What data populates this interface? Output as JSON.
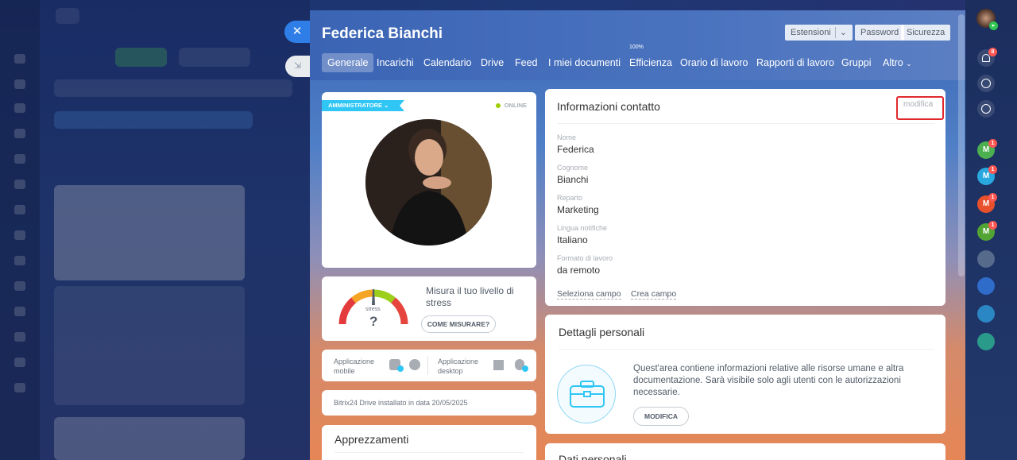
{
  "header": {
    "title": "Federica Bianchi",
    "btn_extensions": "Estensioni",
    "btn_password": "Password",
    "btn_security": "Sicurezza"
  },
  "tabs": [
    {
      "label": "Generale",
      "active": true
    },
    {
      "label": "Incarichi"
    },
    {
      "label": "Calendario"
    },
    {
      "label": "Drive"
    },
    {
      "label": "Feed"
    },
    {
      "label": "I miei documenti"
    },
    {
      "label": "Efficienza",
      "sup": "100%"
    },
    {
      "label": "Orario di lavoro"
    },
    {
      "label": "Rapporti di lavoro"
    },
    {
      "label": "Gruppi"
    },
    {
      "label": "Altro"
    }
  ],
  "profile": {
    "role_badge": "AMMINISTRATORE",
    "status": "ONLINE"
  },
  "stress": {
    "gauge_label": "stress",
    "gauge_value": "?",
    "text": "Misura il tuo livello di stress",
    "button": "COME MISURARE?"
  },
  "apps": {
    "mobile": "Applicazione mobile",
    "desktop": "Applicazione desktop"
  },
  "drive_info": "Bitrix24 Drive installato in data 20/05/2025",
  "appreciations": {
    "title": "Apprezzamenti"
  },
  "contact": {
    "title": "Informazioni contatto",
    "edit_link": "modifica",
    "fields": [
      {
        "label": "Nome",
        "value": "Federica"
      },
      {
        "label": "Cognome",
        "value": "Bianchi"
      },
      {
        "label": "Reparto",
        "value": "Marketing"
      },
      {
        "label": "Lingua notifiche",
        "value": "Italiano"
      },
      {
        "label": "Formato di lavoro",
        "value": "da remoto"
      }
    ],
    "select_field": "Seleziona campo",
    "create_field": "Crea campo"
  },
  "personal_details": {
    "title": "Dettagli personali",
    "description": "Quest'area contiene informazioni relative alle risorse umane e altra documentazione. Sarà visibile solo agli utenti con le autorizzazioni necessarie.",
    "button": "MODIFICA"
  },
  "personal_data": {
    "title": "Dati personali"
  },
  "right_bar": {
    "notifications_count": "8",
    "chat_counters": [
      "1",
      "1",
      "1",
      "1"
    ],
    "avatar_letter": "M"
  },
  "colors": {
    "accent_blue": "#2f7ee8",
    "highlight_red": "#e0292b",
    "online_green": "#9dcf00",
    "badge_cyan": "#2fc6f6"
  }
}
